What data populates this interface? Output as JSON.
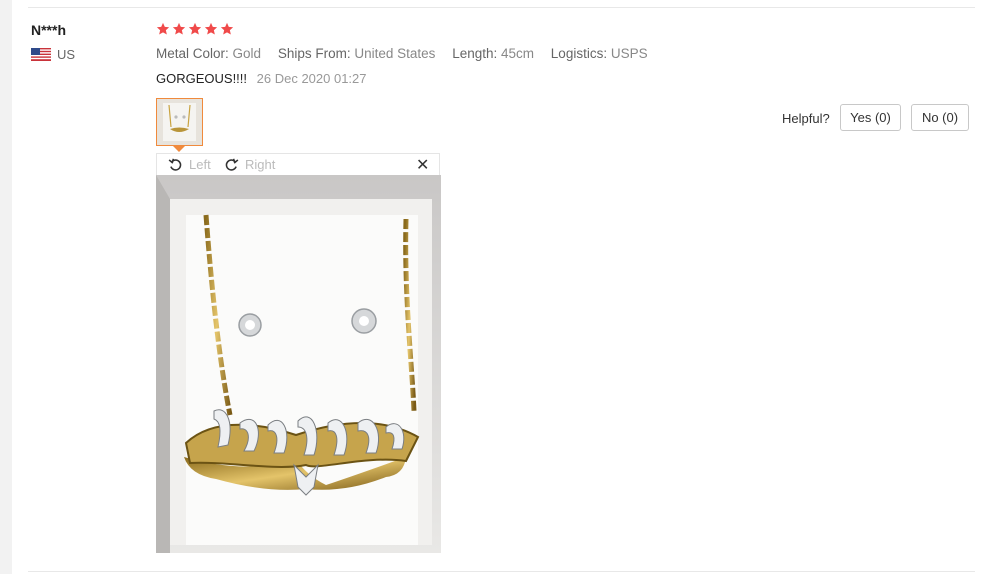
{
  "review": {
    "user_name": "N***h",
    "country": "US",
    "rating": 5,
    "attributes": [
      {
        "label": "Metal Color:",
        "value": "Gold"
      },
      {
        "label": "Ships From:",
        "value": "United States"
      },
      {
        "label": "Length:",
        "value": "45cm"
      },
      {
        "label": "Logistics:",
        "value": "USPS"
      }
    ],
    "text": "GORGEOUS!!!!",
    "date": "26 Dec 2020 01:27"
  },
  "viewer": {
    "rotate_left_label": "Left",
    "rotate_right_label": "Right",
    "close_label": "✕"
  },
  "helpful": {
    "label": "Helpful?",
    "yes_label": "Yes (0)",
    "no_label": "No (0)"
  },
  "colors": {
    "star": "#f04a4a",
    "thumb_border": "#f08a3c"
  }
}
